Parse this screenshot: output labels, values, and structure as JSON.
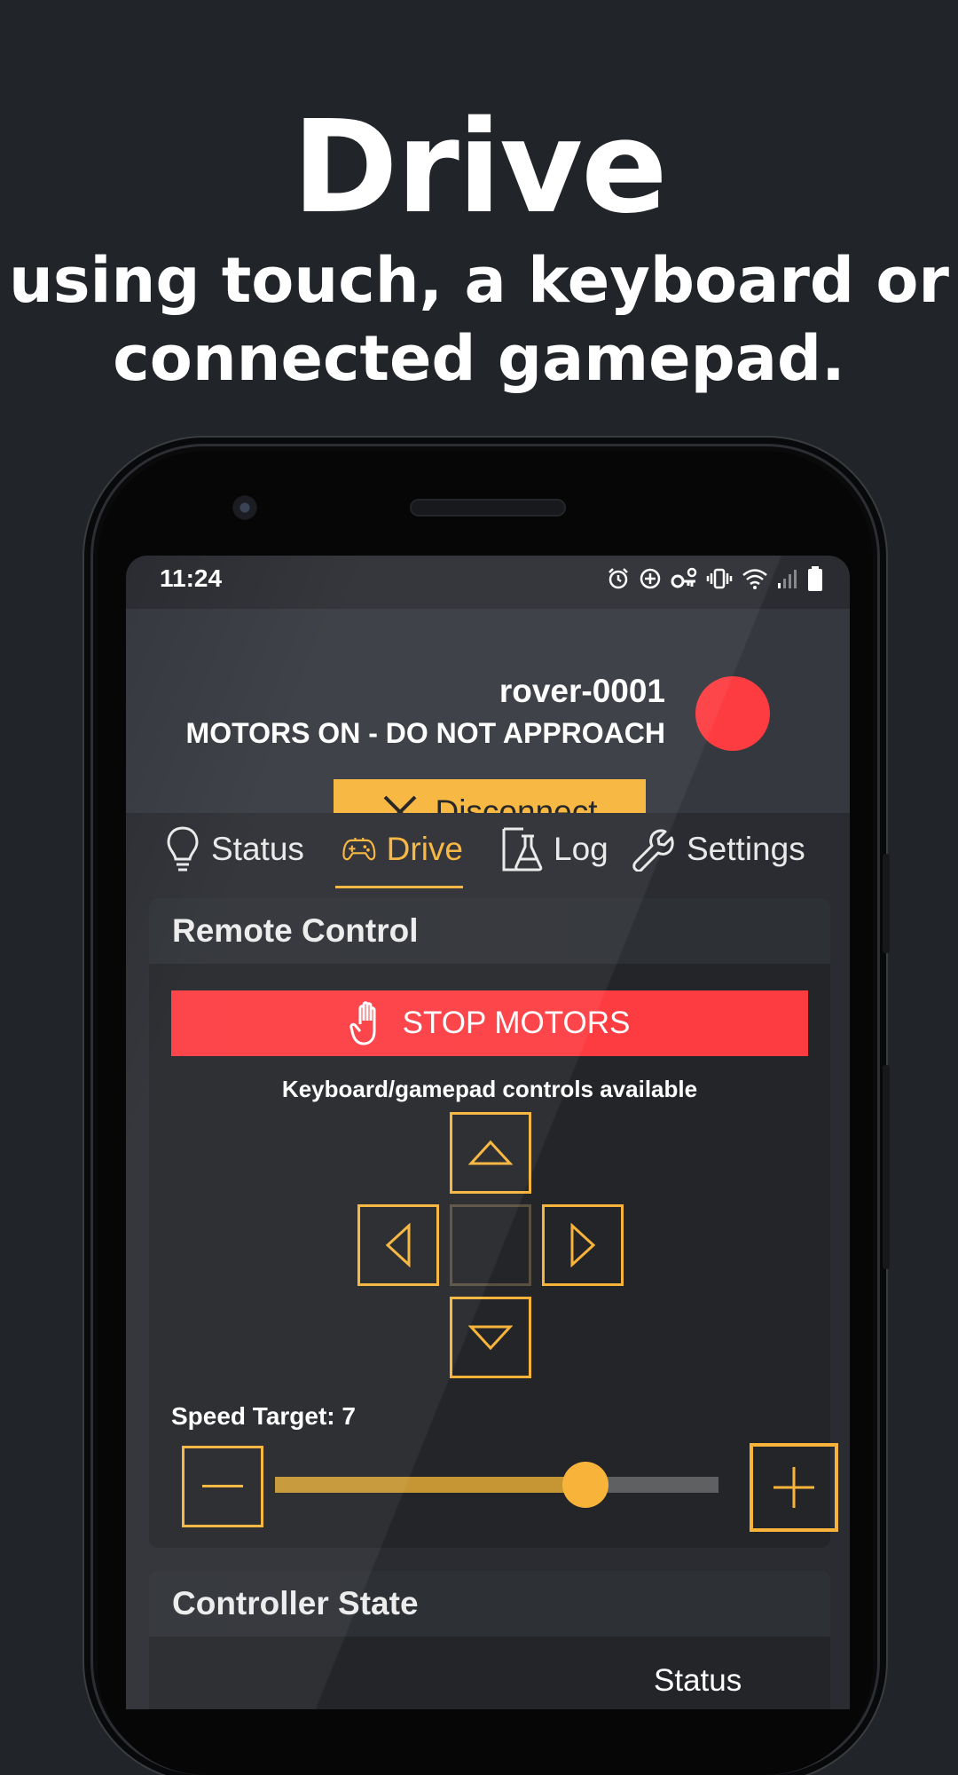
{
  "promo": {
    "title": "Drive",
    "subtitle_line1": "using touch, a keyboard or",
    "subtitle_line2": "connected gamepad."
  },
  "status_bar": {
    "time": "11:24",
    "icons": [
      "alarm-icon",
      "data-saver-icon",
      "vpn-key-icon",
      "vibrate-icon",
      "wifi-icon",
      "signal-icon",
      "battery-icon"
    ]
  },
  "header": {
    "device_name": "rover-0001",
    "warning": "MOTORS ON - DO NOT APPROACH",
    "indicator_color": "#fc3c41",
    "disconnect_label": "Disconnect"
  },
  "tabs": [
    {
      "label": "Status",
      "icon": "lightbulb-icon",
      "active": false
    },
    {
      "label": "Drive",
      "icon": "gamepad-icon",
      "active": true
    },
    {
      "label": "Log",
      "icon": "flask-icon",
      "active": false
    },
    {
      "label": "Settings",
      "icon": "wrench-icon",
      "active": false
    }
  ],
  "remote_control": {
    "title": "Remote Control",
    "stop_label": "STOP MOTORS",
    "keyboard_hint": "Keyboard/gamepad controls available",
    "speed_label": "Speed Target: 7",
    "speed_value": 7,
    "speed_max": 10
  },
  "controller_state": {
    "title": "Controller State",
    "status_label": "Status"
  },
  "colors": {
    "accent": "#f8b43a",
    "danger": "#fc3c41",
    "background": "#212429"
  }
}
